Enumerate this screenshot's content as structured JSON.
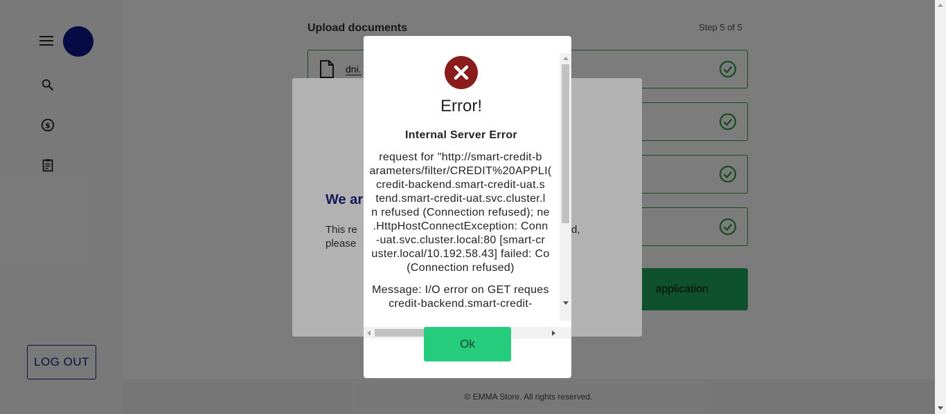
{
  "sidebar": {
    "logout_label": "LOG OUT"
  },
  "main": {
    "upload_title": "Upload documents",
    "step": "Step 5 of 5",
    "documents": [
      {
        "name": "dni."
      },
      {
        "name": ""
      },
      {
        "name": ""
      },
      {
        "name": ""
      }
    ],
    "send_label": "application"
  },
  "footer": {
    "text": "© EMMA Store. All rights reserved."
  },
  "confirm_modal": {
    "title_fragment": "We ar",
    "body_fragment_1": "This re",
    "body_fragment_2": "please",
    "body_right_1": "d,"
  },
  "error_dialog": {
    "title": "Error!",
    "subtitle": "Internal Server Error",
    "detail_lines": [
      "request for \"http://smart-credit-b",
      "arameters/filter/CREDIT%20APPLI(",
      "credit-backend.smart-credit-uat.s",
      "tend.smart-credit-uat.svc.cluster.l",
      "n refused (Connection refused); ne",
      ".HttpHostConnectException: Conn",
      "-uat.svc.cluster.local:80 [smart-cr",
      "uster.local/10.192.58.43] failed: Co",
      "(Connection refused)"
    ],
    "message_lines": [
      "Message: I/O error on GET reques",
      "credit-backend.smart-credit-"
    ],
    "ok_label": "Ok"
  },
  "colors": {
    "accent_green": "#24cc7c",
    "doc_border_green": "#2e9b4a",
    "error_red": "#8b1c1c",
    "navy": "#1a237e"
  }
}
